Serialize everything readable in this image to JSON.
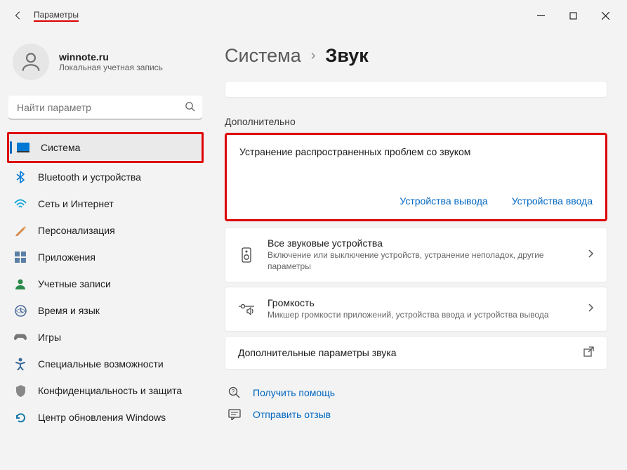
{
  "titlebar": {
    "title": "Параметры"
  },
  "profile": {
    "name": "winnote.ru",
    "sub": "Локальная учетная запись"
  },
  "search": {
    "placeholder": "Найти параметр"
  },
  "nav": {
    "items": [
      {
        "label": "Система",
        "icon": "system"
      },
      {
        "label": "Bluetooth и устройства",
        "icon": "bluetooth"
      },
      {
        "label": "Сеть и Интернет",
        "icon": "network"
      },
      {
        "label": "Персонализация",
        "icon": "personalization"
      },
      {
        "label": "Приложения",
        "icon": "apps"
      },
      {
        "label": "Учетные записи",
        "icon": "accounts"
      },
      {
        "label": "Время и язык",
        "icon": "time"
      },
      {
        "label": "Игры",
        "icon": "gaming"
      },
      {
        "label": "Специальные возможности",
        "icon": "accessibility"
      },
      {
        "label": "Конфиденциальность и защита",
        "icon": "privacy"
      },
      {
        "label": "Центр обновления Windows",
        "icon": "update"
      }
    ]
  },
  "breadcrumb": {
    "parent": "Система",
    "current": "Звук"
  },
  "section": {
    "title": "Дополнительно"
  },
  "troubleshoot": {
    "title": "Устранение распространенных проблем со звуком",
    "link_output": "Устройства вывода",
    "link_input": "Устройства ввода"
  },
  "rows": {
    "devices": {
      "title": "Все звуковые устройства",
      "sub": "Включение или выключение устройств, устранение неполадок, другие параметры"
    },
    "volume": {
      "title": "Громкость",
      "sub": "Микшер громкости приложений, устройства ввода и устройства вывода"
    },
    "more": {
      "title": "Дополнительные параметры звука"
    }
  },
  "footer": {
    "help": "Получить помощь",
    "feedback": "Отправить отзыв"
  }
}
